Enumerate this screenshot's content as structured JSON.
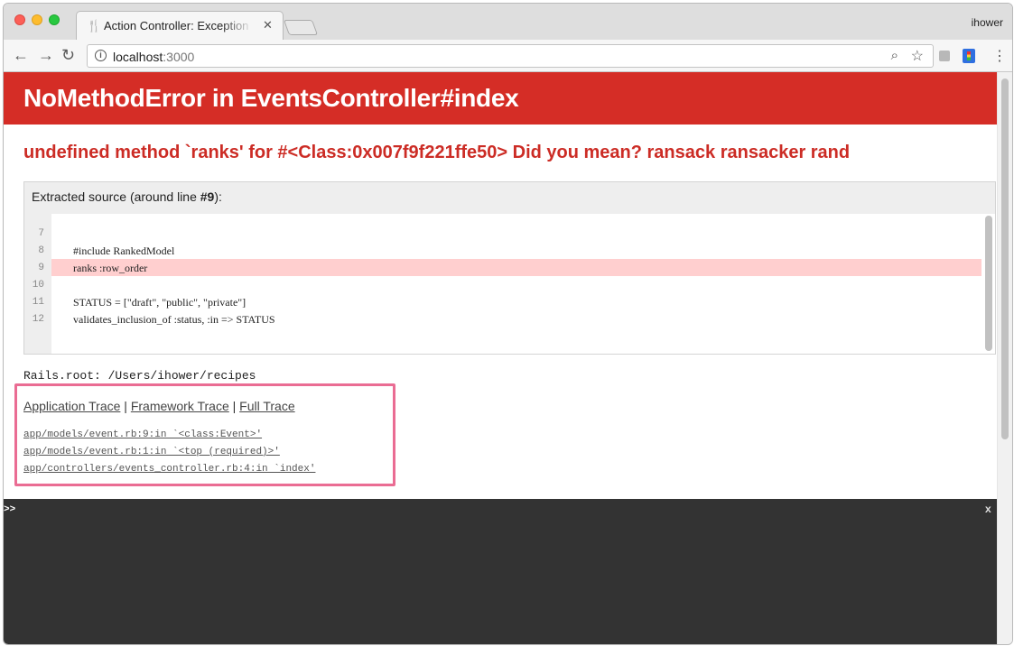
{
  "browser": {
    "tab_title": "Action Controller: Exception caught",
    "tab_close": "✕",
    "profile_name": "ihower",
    "url_host": "localhost",
    "url_port": ":3000",
    "nav": {
      "back": "←",
      "forward": "→",
      "reload": "↻"
    },
    "menu": "⋮"
  },
  "page": {
    "header_title": "NoMethodError in EventsController#index",
    "error_message": "undefined method `ranks' for #<Class:0x007f9f221ffe50> Did you mean? ransack ransacker rand",
    "source_caption_prefix": "Extracted source (around line ",
    "source_caption_line": "#9",
    "source_caption_suffix": "):",
    "source_lines": [
      {
        "num": "7",
        "code": ""
      },
      {
        "num": "8",
        "code": "#include RankedModel"
      },
      {
        "num": "9",
        "code": "ranks :row_order"
      },
      {
        "num": "10",
        "code": ""
      },
      {
        "num": "11",
        "code": "STATUS = [\"draft\", \"public\", \"private\"]"
      },
      {
        "num": "12",
        "code": "validates_inclusion_of :status, :in => STATUS"
      }
    ],
    "rails_root": "Rails.root: /Users/ihower/recipes",
    "trace_links": {
      "application": "Application Trace",
      "framework": "Framework Trace",
      "full": "Full Trace",
      "separator": "|"
    },
    "frames": [
      "app/models/event.rb:9:in `<class:Event>'",
      "app/models/event.rb:1:in `<top (required)>'",
      "app/controllers/events_controller.rb:4:in `index'"
    ],
    "console_prompt": ">>",
    "console_close": "x"
  },
  "colors": {
    "header_bg": "#d52d26",
    "error_text": "#cc2c25",
    "highlight_line": "#ffcfcf",
    "annotation_box": "#ea6c93",
    "console_bg": "#333333"
  }
}
